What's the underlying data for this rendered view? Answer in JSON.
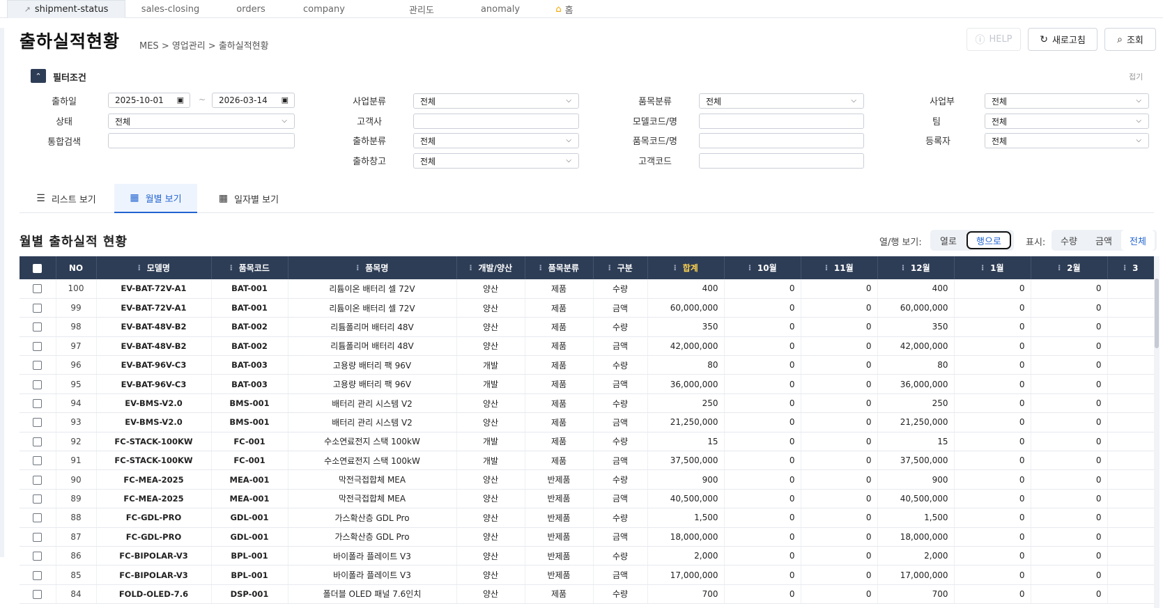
{
  "tabs": [
    {
      "label": "shipment-status",
      "icon": "external-link-icon",
      "active": true
    },
    {
      "label": "sales-closing"
    },
    {
      "label": "orders"
    },
    {
      "label": "company"
    },
    {
      "label": "관리도"
    },
    {
      "label": "anomaly"
    },
    {
      "label": "홈",
      "icon": "home-icon"
    }
  ],
  "header": {
    "title": "출하실적현황",
    "breadcrumb": "MES  >  영업관리  >  출하실적현황",
    "help_label": "HELP",
    "refresh_label": "새로고침",
    "search_label": "조회"
  },
  "filter": {
    "title": "필터조건",
    "collapse_label": "접기",
    "ship_date_label": "출하일",
    "date_from": "2025-10-01",
    "date_to": "2026-03-14",
    "date_sep": "~",
    "status_label": "상태",
    "status_value": "전체",
    "search_label": "통합검색",
    "search_value": "",
    "biz_class_label": "사업분류",
    "biz_class_value": "전체",
    "customer_label": "고객사",
    "customer_value": "",
    "ship_class_label": "출하분류",
    "ship_class_value": "전체",
    "ship_wh_label": "출하창고",
    "ship_wh_value": "전체",
    "item_class_label": "품목분류",
    "item_class_value": "전체",
    "model_label": "모델코드/명",
    "model_value": "",
    "item_code_label": "품목코드/명",
    "item_code_value": "",
    "cust_code_label": "고객코드",
    "cust_code_value": "",
    "biz_dept_label": "사업부",
    "biz_dept_value": "전체",
    "team_label": "팀",
    "team_value": "전체",
    "registrant_label": "등록자",
    "registrant_value": "전체"
  },
  "view_tabs": [
    {
      "label": "리스트 보기",
      "icon": "list-icon"
    },
    {
      "label": "월별 보기",
      "icon": "calendar-icon",
      "active": true
    },
    {
      "label": "일자별 보기",
      "icon": "calendar-days-icon"
    }
  ],
  "section": {
    "title": "월별 출하실적 현황",
    "orient_label": "열/행 보기:",
    "orient_options": [
      "열로",
      "행으로"
    ],
    "orient_selected": "행으로",
    "display_label": "표시:",
    "display_options": [
      "수량",
      "금액",
      "전체"
    ],
    "display_selected": "전체"
  },
  "table": {
    "columns": [
      "NO",
      "모델명",
      "품목코드",
      "품목명",
      "개발/양산",
      "품목분류",
      "구분",
      "합계",
      "10월",
      "11월",
      "12월",
      "1월",
      "2월",
      "3"
    ],
    "rows": [
      [
        "100",
        "EV-BAT-72V-A1",
        "BAT-001",
        "리튬이온 배터리 셀 72V",
        "양산",
        "제품",
        "수량",
        "400",
        "0",
        "0",
        "400",
        "0",
        "0"
      ],
      [
        "99",
        "EV-BAT-72V-A1",
        "BAT-001",
        "리튬이온 배터리 셀 72V",
        "양산",
        "제품",
        "금액",
        "60,000,000",
        "0",
        "0",
        "60,000,000",
        "0",
        "0"
      ],
      [
        "98",
        "EV-BAT-48V-B2",
        "BAT-002",
        "리튬폴리머 배터리 48V",
        "양산",
        "제품",
        "수량",
        "350",
        "0",
        "0",
        "350",
        "0",
        "0"
      ],
      [
        "97",
        "EV-BAT-48V-B2",
        "BAT-002",
        "리튬폴리머 배터리 48V",
        "양산",
        "제품",
        "금액",
        "42,000,000",
        "0",
        "0",
        "42,000,000",
        "0",
        "0"
      ],
      [
        "96",
        "EV-BAT-96V-C3",
        "BAT-003",
        "고용량 배터리 팩 96V",
        "개발",
        "제품",
        "수량",
        "80",
        "0",
        "0",
        "80",
        "0",
        "0"
      ],
      [
        "95",
        "EV-BAT-96V-C3",
        "BAT-003",
        "고용량 배터리 팩 96V",
        "개발",
        "제품",
        "금액",
        "36,000,000",
        "0",
        "0",
        "36,000,000",
        "0",
        "0"
      ],
      [
        "94",
        "EV-BMS-V2.0",
        "BMS-001",
        "배터리 관리 시스템 V2",
        "양산",
        "제품",
        "수량",
        "250",
        "0",
        "0",
        "250",
        "0",
        "0"
      ],
      [
        "93",
        "EV-BMS-V2.0",
        "BMS-001",
        "배터리 관리 시스템 V2",
        "양산",
        "제품",
        "금액",
        "21,250,000",
        "0",
        "0",
        "21,250,000",
        "0",
        "0"
      ],
      [
        "92",
        "FC-STACK-100KW",
        "FC-001",
        "수소연료전지 스택 100kW",
        "개발",
        "제품",
        "수량",
        "15",
        "0",
        "0",
        "15",
        "0",
        "0"
      ],
      [
        "91",
        "FC-STACK-100KW",
        "FC-001",
        "수소연료전지 스택 100kW",
        "개발",
        "제품",
        "금액",
        "37,500,000",
        "0",
        "0",
        "37,500,000",
        "0",
        "0"
      ],
      [
        "90",
        "FC-MEA-2025",
        "MEA-001",
        "막전극접합체 MEA",
        "양산",
        "반제품",
        "수량",
        "900",
        "0",
        "0",
        "900",
        "0",
        "0"
      ],
      [
        "89",
        "FC-MEA-2025",
        "MEA-001",
        "막전극접합체 MEA",
        "양산",
        "반제품",
        "금액",
        "40,500,000",
        "0",
        "0",
        "40,500,000",
        "0",
        "0"
      ],
      [
        "88",
        "FC-GDL-PRO",
        "GDL-001",
        "가스확산층 GDL Pro",
        "양산",
        "반제품",
        "수량",
        "1,500",
        "0",
        "0",
        "1,500",
        "0",
        "0"
      ],
      [
        "87",
        "FC-GDL-PRO",
        "GDL-001",
        "가스확산층 GDL Pro",
        "양산",
        "반제품",
        "금액",
        "18,000,000",
        "0",
        "0",
        "18,000,000",
        "0",
        "0"
      ],
      [
        "86",
        "FC-BIPOLAR-V3",
        "BPL-001",
        "바이폴라 플레이트 V3",
        "양산",
        "반제품",
        "수량",
        "2,000",
        "0",
        "0",
        "2,000",
        "0",
        "0"
      ],
      [
        "85",
        "FC-BIPOLAR-V3",
        "BPL-001",
        "바이폴라 플레이트 V3",
        "양산",
        "반제품",
        "금액",
        "17,000,000",
        "0",
        "0",
        "17,000,000",
        "0",
        "0"
      ],
      [
        "84",
        "FOLD-OLED-7.6",
        "DSP-001",
        "폴더블 OLED 패널 7.6인치",
        "양산",
        "제품",
        "수량",
        "700",
        "0",
        "0",
        "700",
        "0",
        "0"
      ]
    ]
  },
  "colors": {
    "header_bg": "#2e3d56",
    "accent": "#2264d1",
    "total_header": "#ffd24d"
  }
}
